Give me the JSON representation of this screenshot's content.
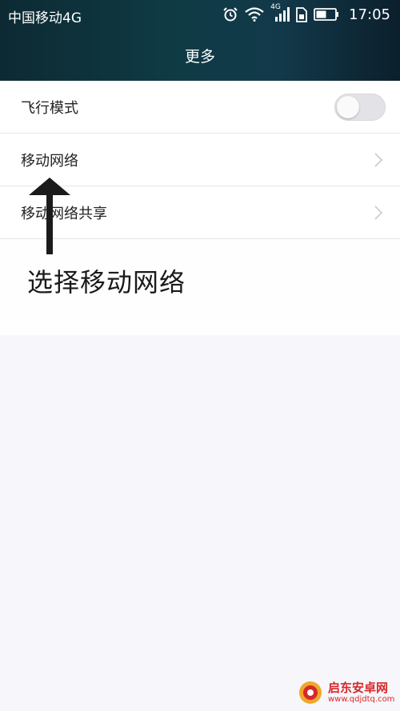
{
  "status_bar": {
    "carrier": "中国移动4G",
    "network_badge": "4G",
    "time": "17:05",
    "icons": [
      "alarm-icon",
      "wifi-icon",
      "signal-icon",
      "sim-icon",
      "battery-icon"
    ]
  },
  "header": {
    "title": "更多"
  },
  "settings": [
    {
      "label": "飞行模式",
      "control": "toggle",
      "toggle_on": false
    },
    {
      "label": "移动网络",
      "control": "chevron"
    },
    {
      "label": "移动网络共享",
      "control": "chevron"
    }
  ],
  "annotation": {
    "text": "选择移动网络"
  },
  "watermark": {
    "name": "启东安卓网",
    "url": "www.qdjdtq.com"
  },
  "colors": {
    "header_bg": "#0f3b45",
    "page_bg": "#f7f6fa",
    "watermark_red": "#d6282b"
  }
}
